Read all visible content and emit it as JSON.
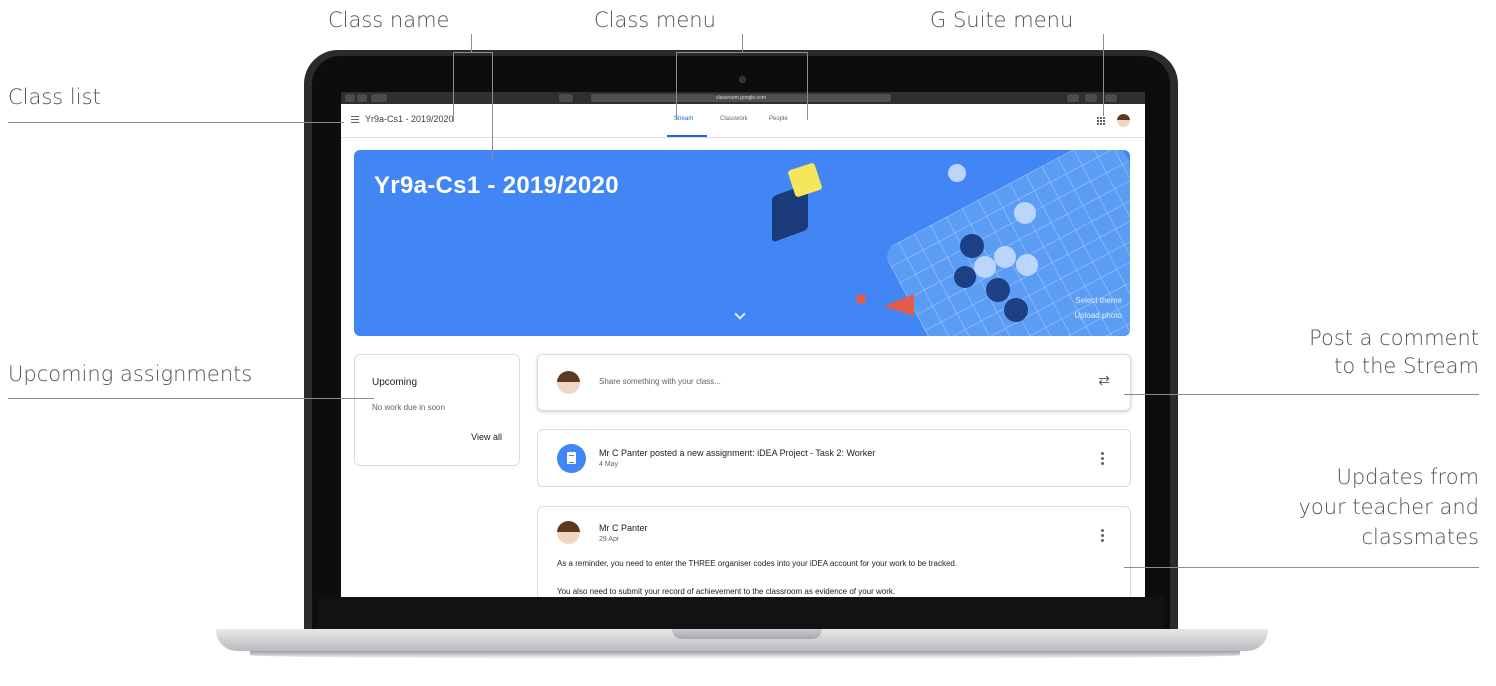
{
  "annotations": {
    "class_name": "Class name",
    "class_menu": "Class menu",
    "gsuite_menu": "G Suite menu",
    "class_list": "Class list",
    "upcoming_assignments": "Upcoming assignments",
    "post_comment_line1": "Post a comment",
    "post_comment_line2": "to the Stream",
    "updates_line1": "Updates from",
    "updates_line2": "your teacher and",
    "updates_line3": "classmates"
  },
  "browser": {
    "url": "classroom.google.com"
  },
  "header": {
    "class_name": "Yr9a-Cs1 - 2019/2020",
    "tabs": [
      {
        "label": "Stream",
        "active": true
      },
      {
        "label": "Classwork",
        "active": false
      },
      {
        "label": "People",
        "active": false
      }
    ]
  },
  "banner": {
    "title": "Yr9a-Cs1 - 2019/2020",
    "select_theme": "Select theme",
    "upload_photo": "Upload photo",
    "color": "#4285f4"
  },
  "upcoming": {
    "title": "Upcoming",
    "text": "No work due in soon",
    "view_all": "View all"
  },
  "share": {
    "placeholder": "Share something with your class..."
  },
  "stream": [
    {
      "title": "Mr C Panter posted a new assignment: iDEA Project - Task 2: Worker",
      "date": "4 May"
    },
    {
      "author": "Mr C Panter",
      "date": "29 Apr",
      "body_line1": "As a reminder, you need to enter the THREE organiser codes into your iDEA account for your work to be tracked.",
      "body_line2": "You also need to submit your record of achievement to the classroom as evidence of your work."
    }
  ],
  "colors": {
    "accent": "#1967d2",
    "banner": "#4285f4"
  }
}
